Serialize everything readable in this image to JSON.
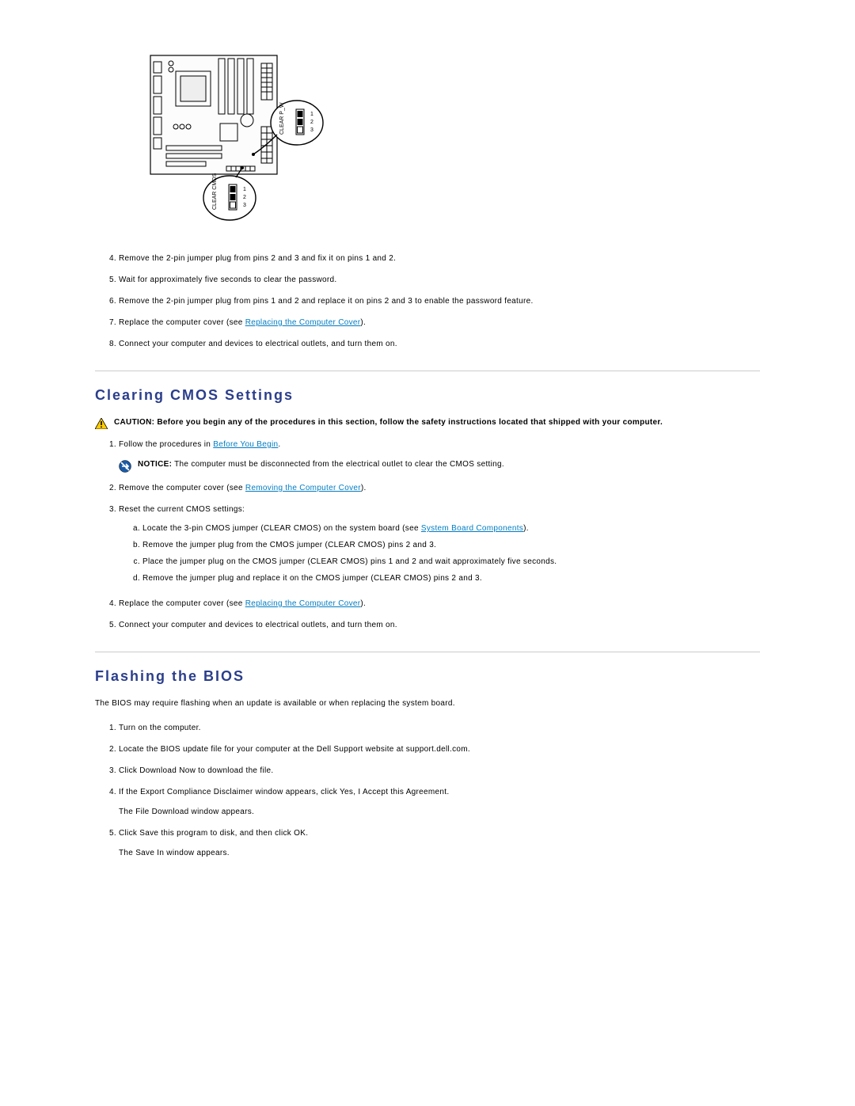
{
  "diagram": {
    "label_clear_pw": "CLEAR P_W",
    "label_clear_cmos": "CLEAR CMOS",
    "pins_a": [
      "1",
      "2",
      "3"
    ],
    "pins_b": [
      "1",
      "2",
      "3"
    ]
  },
  "list1": {
    "item4": "Remove the 2-pin jumper plug from pins 2 and 3 and fix it on pins 1 and 2.",
    "item5": "Wait for approximately five seconds to clear the password.",
    "item6": "Remove the 2-pin jumper plug from pins 1 and 2 and replace it on pins 2 and 3 to enable the password feature.",
    "item7_prefix": "Replace the computer cover (see ",
    "item7_link": "Replacing the Computer Cover",
    "item7_suffix": ").",
    "item8": "Connect your computer and devices to electrical outlets, and turn them on."
  },
  "section_cmos": {
    "title": "Clearing CMOS Settings",
    "caution_label": "CAUTION:",
    "caution_text": " Before you begin any of the procedures in this section, follow the safety instructions located that shipped with your computer.",
    "step1_prefix": "Follow the procedures in ",
    "step1_link": "Before You Begin",
    "step1_suffix": ".",
    "notice_label": "NOTICE:",
    "notice_text": " The computer must be disconnected from the electrical outlet to clear the CMOS setting.",
    "step2_prefix": "Remove the computer cover (see ",
    "step2_link": "Removing the Computer Cover",
    "step2_suffix": ").",
    "step3": "Reset the current CMOS settings:",
    "step3a_prefix": "Locate the 3-pin CMOS jumper (CLEAR CMOS) on the system board (see ",
    "step3a_link": "System Board Components",
    "step3a_suffix": ").",
    "step3b": "Remove the jumper plug from the CMOS jumper (CLEAR CMOS) pins 2 and 3.",
    "step3c": "Place the jumper plug on the CMOS jumper (CLEAR CMOS) pins 1 and 2 and wait approximately five seconds.",
    "step3d": "Remove the jumper plug and replace it on the CMOS jumper (CLEAR CMOS) pins 2 and 3.",
    "step4_prefix": "Replace the computer cover (see ",
    "step4_link": "Replacing the Computer Cover",
    "step4_suffix": ").",
    "step5": "Connect your computer and devices to electrical outlets, and turn them on."
  },
  "section_bios": {
    "title": "Flashing the BIOS",
    "intro": "The BIOS may require flashing when an update is available or when replacing the system board.",
    "step1": "Turn on the computer.",
    "step2": "Locate the BIOS update file for your computer at the Dell Support website at support.dell.com.",
    "step3": "Click Download Now to download the file.",
    "step4": "If the Export Compliance Disclaimer window appears, click Yes, I Accept this Agreement.",
    "step4_followup": "The File Download window appears.",
    "step5": "Click Save this program to disk, and then click OK.",
    "step5_followup": "The Save In window appears."
  }
}
